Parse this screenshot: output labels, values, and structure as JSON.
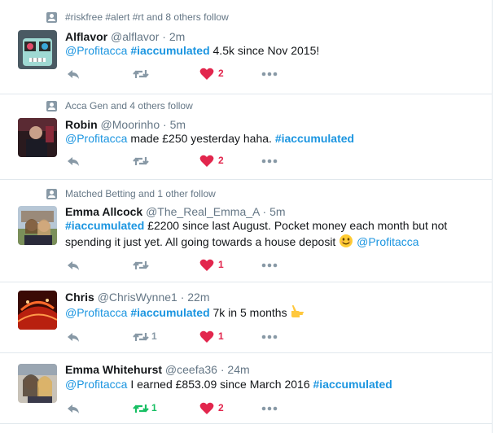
{
  "tweets": [
    {
      "context": "#riskfree #alert #rt and 8 others follow",
      "name": "Alflavor",
      "handle": "@alflavor",
      "sep": "·",
      "time": "2m",
      "body": [
        {
          "t": "@Profitacca",
          "k": "m"
        },
        {
          "t": " ",
          "k": "p"
        },
        {
          "t": "#iaccumulated",
          "k": "h"
        },
        {
          "t": " 4.5k since Nov 2015!",
          "k": "p"
        }
      ],
      "retweets": "",
      "likes": "2",
      "liked": true,
      "retweeted": false
    },
    {
      "context": "Acca Gen and 4 others follow",
      "name": "Robin",
      "handle": "@Moorinho",
      "sep": "·",
      "time": "5m",
      "body": [
        {
          "t": "@Profitacca",
          "k": "m"
        },
        {
          "t": " made £250 yesterday haha. ",
          "k": "p"
        },
        {
          "t": "#iaccumulated",
          "k": "h"
        }
      ],
      "retweets": "",
      "likes": "2",
      "liked": true,
      "retweeted": false
    },
    {
      "context": "Matched Betting and 1 other follow",
      "name": "Emma Allcock",
      "handle": "@The_Real_Emma_A",
      "sep": "·",
      "time": "5m",
      "body": [
        {
          "t": "#iaccumulated",
          "k": "h"
        },
        {
          "t": " £2200 since last August. Pocket money each month but not spending it just yet. All going towards a house deposit ",
          "k": "p"
        },
        {
          "t": "smiling-emoji",
          "k": "e"
        },
        {
          "t": " ",
          "k": "p"
        },
        {
          "t": "@Profitacca",
          "k": "m"
        }
      ],
      "retweets": "",
      "likes": "1",
      "liked": true,
      "retweeted": false
    },
    {
      "context": "",
      "name": "Chris",
      "handle": "@ChrisWynne1",
      "sep": "·",
      "time": "22m",
      "body": [
        {
          "t": "@Profitacca",
          "k": "m"
        },
        {
          "t": "  ",
          "k": "p"
        },
        {
          "t": "#iaccumulated",
          "k": "h"
        },
        {
          "t": " 7k in 5 months ",
          "k": "p"
        },
        {
          "t": "pointing-hand-emoji",
          "k": "e2"
        }
      ],
      "retweets": "1",
      "likes": "1",
      "liked": true,
      "retweeted": false
    },
    {
      "context": "",
      "name": "Emma Whitehurst",
      "handle": "@ceefa36",
      "sep": "·",
      "time": "24m",
      "body": [
        {
          "t": "@Profitacca",
          "k": "m"
        },
        {
          "t": " I earned £853.09 since March 2016 ",
          "k": "p"
        },
        {
          "t": "#iaccumulated",
          "k": "h"
        }
      ],
      "retweets": "1",
      "likes": "2",
      "liked": true,
      "retweeted": true
    }
  ],
  "colors": {
    "like": "#e2264d",
    "retweet_active": "#17bf63",
    "icon": "#8899a6",
    "link": "#1b95e0",
    "muted": "#657786"
  },
  "icons": {
    "reply": "reply-icon",
    "retweet": "retweet-icon",
    "like": "heart-icon",
    "more": "more-dots-icon",
    "context": "person-follow-icon"
  }
}
